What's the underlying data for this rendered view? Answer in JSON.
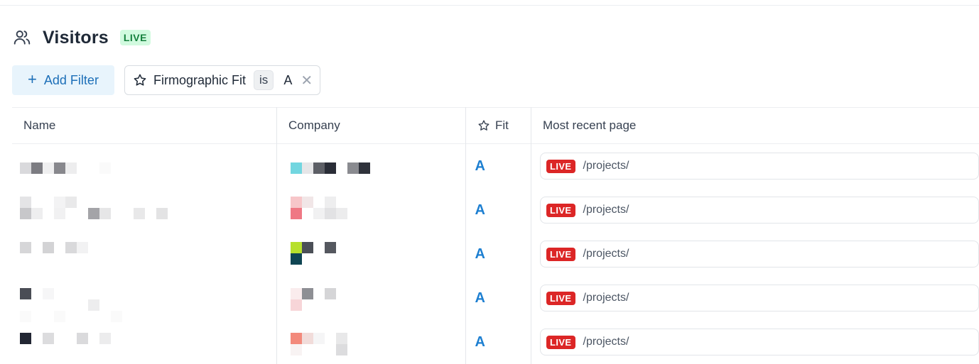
{
  "page": {
    "title": "Visitors",
    "live_badge": "LIVE",
    "title_icon": "users-icon"
  },
  "filters": {
    "add_label": "Add Filter",
    "active": {
      "field": "Firmographic Fit",
      "operator": "is",
      "value": "A",
      "icon": "star-icon"
    }
  },
  "table": {
    "columns": {
      "name": "Name",
      "company": "Company",
      "fit": "Fit",
      "page": "Most recent page"
    },
    "rows": [
      {
        "fit": "A",
        "badge": "LIVE",
        "page": "/projects/"
      },
      {
        "fit": "A",
        "badge": "LIVE",
        "page": "/projects/"
      },
      {
        "fit": "A",
        "badge": "LIVE",
        "page": "/projects/"
      },
      {
        "fit": "A",
        "badge": "LIVE",
        "page": "/projects/"
      },
      {
        "fit": "A",
        "badge": "LIVE",
        "page": "/projects/"
      }
    ]
  },
  "colors": {
    "accent": "#1d7fd1",
    "live_green_bg": "#d1fadf",
    "live_red": "#dc2626"
  }
}
